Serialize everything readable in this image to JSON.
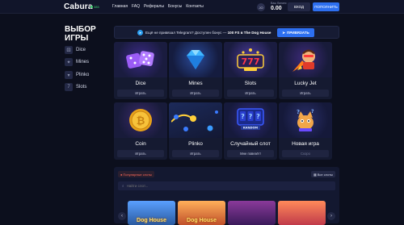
{
  "header": {
    "logo": "Cabura",
    "online": "385",
    "nav": [
      "Главная",
      "FAQ",
      "Рефералы",
      "Бонусы",
      "Контакты"
    ],
    "avatar": "JO",
    "balance_label": "Ваш баланс",
    "balance_value": "0.00",
    "login": "ВХОД",
    "deposit": "ПОПОЛНИТЬ"
  },
  "sidebar": {
    "title": "ВЫБОР ИГРЫ",
    "items": [
      {
        "label": "Dice",
        "icon": "dice-icon"
      },
      {
        "label": "Mines",
        "icon": "mines-icon"
      },
      {
        "label": "Plinko",
        "icon": "plinko-icon"
      },
      {
        "label": "Slots",
        "icon": "slots-icon"
      }
    ]
  },
  "banner": {
    "text_pre": "Ещё не привязал Telegram? Доступен бонус — ",
    "text_bold": "100 FS в The Dog House",
    "button": "ПРИВЯЗАТЬ"
  },
  "games": [
    {
      "name": "Dice",
      "action": "Играть"
    },
    {
      "name": "Mines",
      "action": "Играть"
    },
    {
      "name": "Slots",
      "action": "Играть"
    },
    {
      "name": "Lucky Jet",
      "action": "Играть"
    },
    {
      "name": "Coin",
      "action": "Играть"
    },
    {
      "name": "Plinko",
      "action": "Играть"
    },
    {
      "name": "Случайный слот",
      "action": "Мне повезёт!"
    },
    {
      "name": "Новая игра",
      "action": "Скоро"
    }
  ],
  "random_label": "RANDOM",
  "slots_section": {
    "tag": "Популярные слоты",
    "all": "Все слоты",
    "search_placeholder": "Найти слот...",
    "thumb_text": "Dog House"
  },
  "colors": {
    "accent": "#2d6ff0",
    "background": "#0c0f1d",
    "card": "#151a31"
  }
}
